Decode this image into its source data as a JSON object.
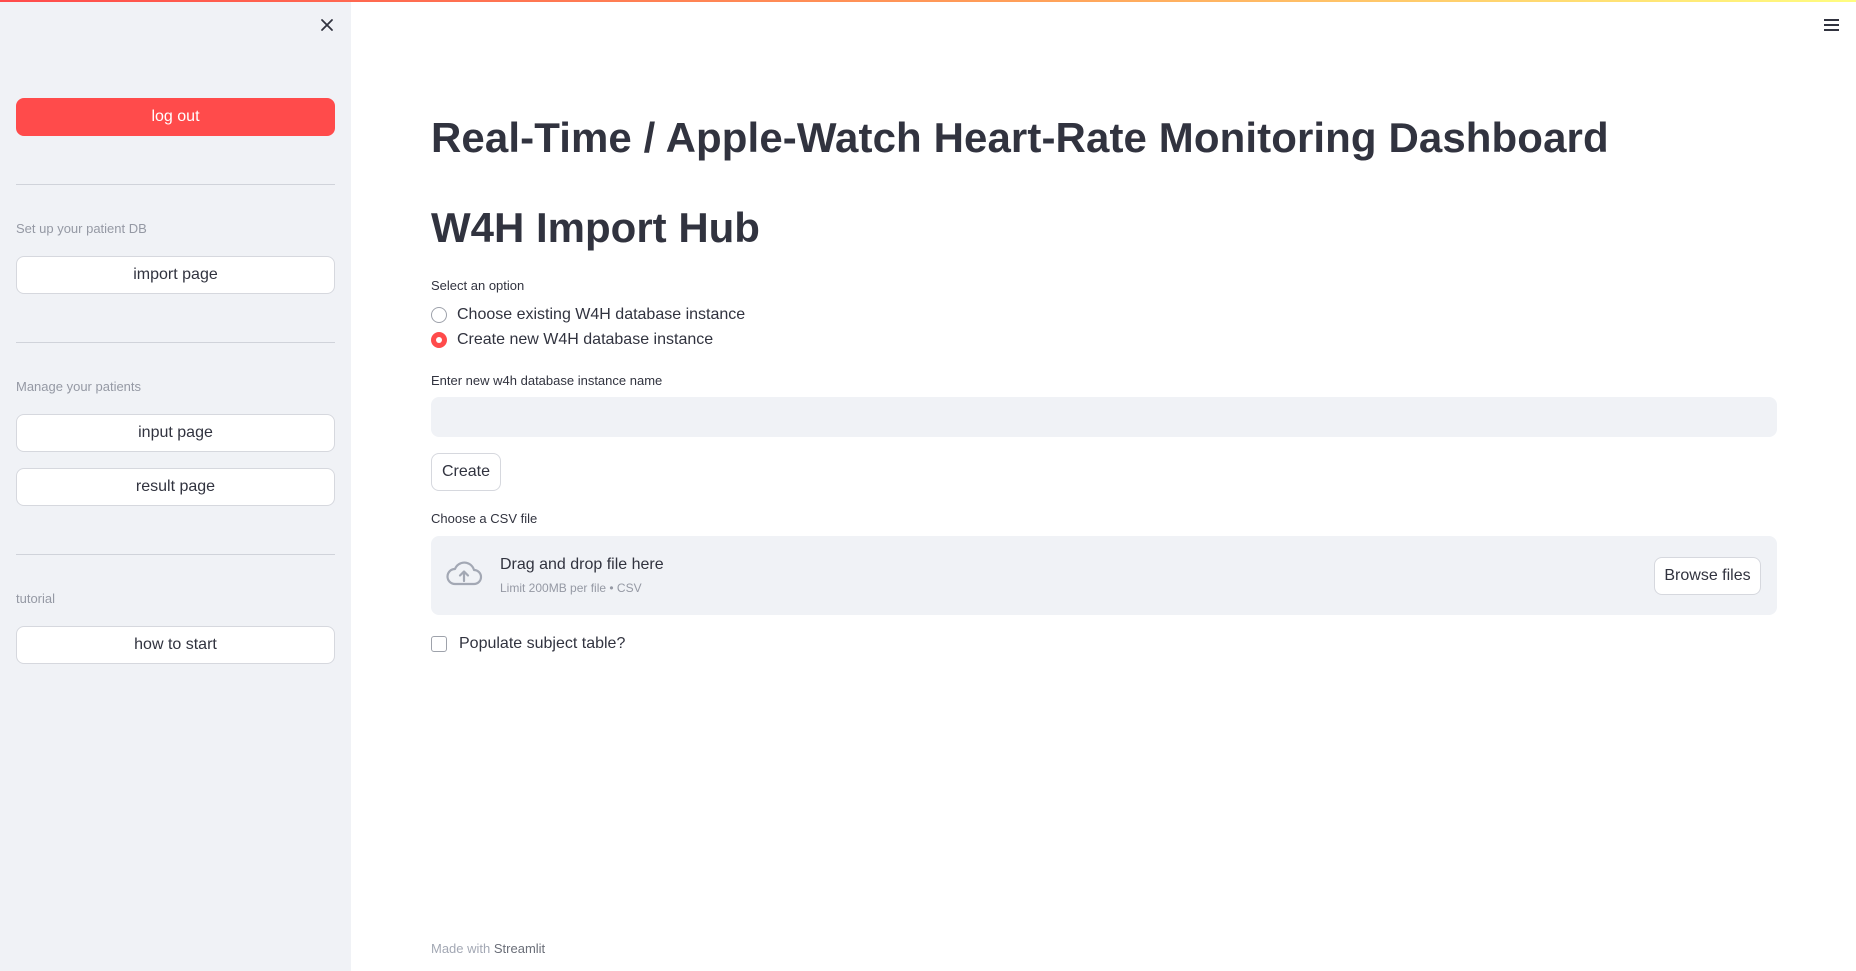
{
  "sidebar": {
    "logout_label": "log out",
    "sections": [
      {
        "caption": "Set up your patient DB",
        "buttons": [
          "import page"
        ]
      },
      {
        "caption": "Manage your patients",
        "buttons": [
          "input page",
          "result page"
        ]
      },
      {
        "caption": "tutorial",
        "buttons": [
          "how to start"
        ]
      }
    ]
  },
  "main": {
    "title": "Real-Time / Apple-Watch Heart-Rate Monitoring Dashboard",
    "section_title": "W4H Import Hub",
    "radio": {
      "label": "Select an option",
      "options": [
        "Choose existing W4H database instance",
        "Create new W4H database instance"
      ],
      "selected": "Create new W4H database instance"
    },
    "name_input": {
      "label": "Enter new w4h database instance name",
      "value": "",
      "placeholder": ""
    },
    "create_label": "Create",
    "uploader": {
      "label": "Choose a CSV file",
      "drag_text": "Drag and drop file here",
      "limit_text": "Limit 200MB per file • CSV",
      "browse_label": "Browse files"
    },
    "checkbox": {
      "label": "Populate subject table?",
      "checked": false
    }
  },
  "footer": {
    "prefix": "Made with",
    "brand": "Streamlit"
  },
  "colors": {
    "primary": "#ff4b4b",
    "sidebar_bg": "#f0f2f6",
    "text": "#31333f"
  },
  "icons": [
    "close-icon",
    "hamburger-menu-icon",
    "cloud-upload-icon"
  ]
}
